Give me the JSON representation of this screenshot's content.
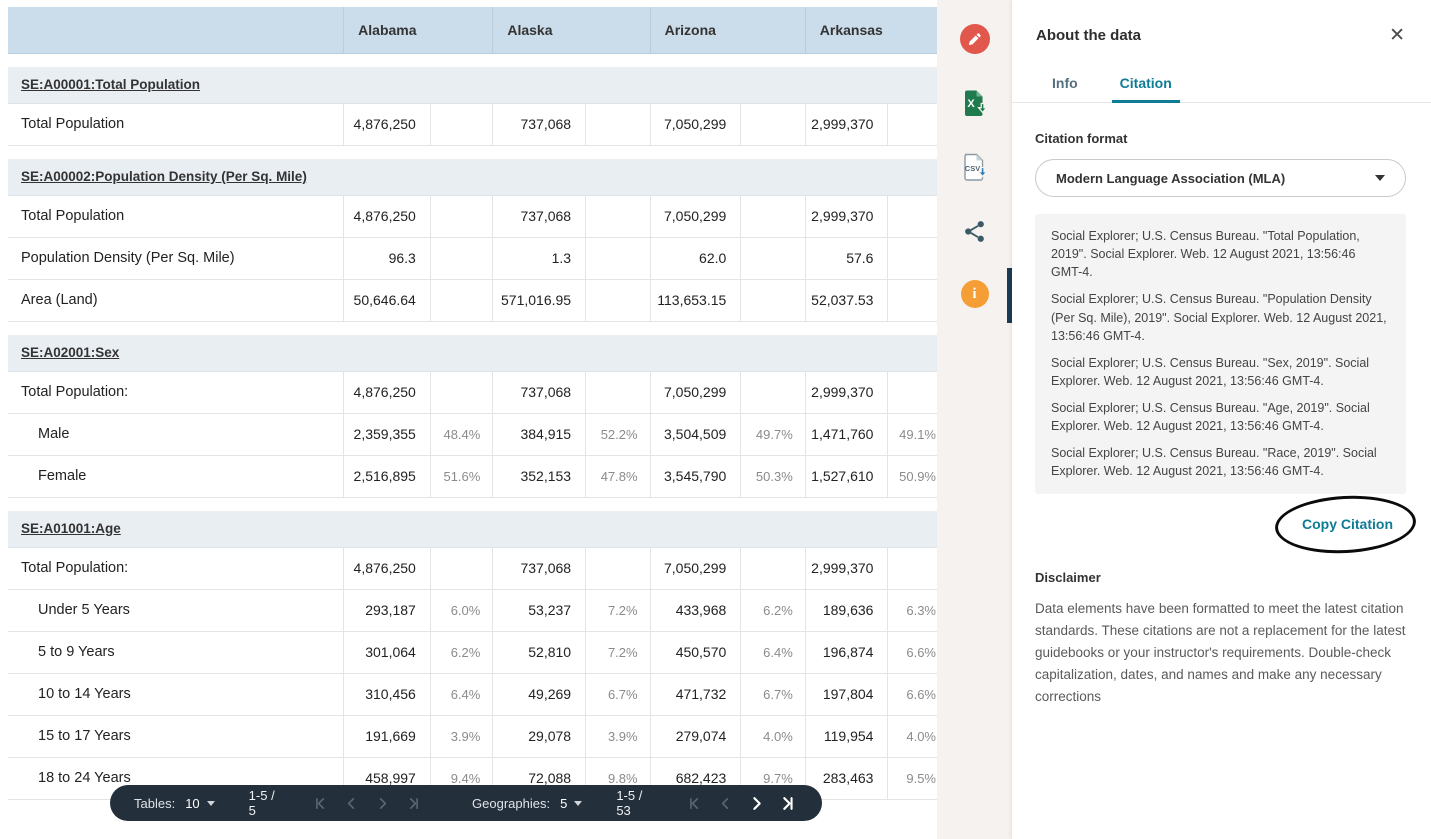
{
  "table": {
    "columns": [
      "Alabama",
      "Alaska",
      "Arizona",
      "Arkansas"
    ],
    "sections": [
      {
        "title": "SE:A00001:Total Population",
        "rows": [
          {
            "label": "Total Population",
            "indent": false,
            "cells": [
              [
                "4,876,250",
                ""
              ],
              [
                "737,068",
                ""
              ],
              [
                "7,050,299",
                ""
              ],
              [
                "2,999,370",
                ""
              ]
            ]
          }
        ]
      },
      {
        "title": "SE:A00002:Population Density (Per Sq. Mile)",
        "rows": [
          {
            "label": "Total Population",
            "indent": false,
            "cells": [
              [
                "4,876,250",
                ""
              ],
              [
                "737,068",
                ""
              ],
              [
                "7,050,299",
                ""
              ],
              [
                "2,999,370",
                ""
              ]
            ]
          },
          {
            "label": "Population Density (Per Sq. Mile)",
            "indent": false,
            "cells": [
              [
                "96.3",
                ""
              ],
              [
                "1.3",
                ""
              ],
              [
                "62.0",
                ""
              ],
              [
                "57.6",
                ""
              ]
            ]
          },
          {
            "label": "Area (Land)",
            "indent": false,
            "cells": [
              [
                "50,646.64",
                ""
              ],
              [
                "571,016.95",
                ""
              ],
              [
                "113,653.15",
                ""
              ],
              [
                "52,037.53",
                ""
              ]
            ]
          }
        ]
      },
      {
        "title": "SE:A02001:Sex",
        "rows": [
          {
            "label": "Total Population:",
            "indent": false,
            "cells": [
              [
                "4,876,250",
                ""
              ],
              [
                "737,068",
                ""
              ],
              [
                "7,050,299",
                ""
              ],
              [
                "2,999,370",
                ""
              ]
            ]
          },
          {
            "label": "Male",
            "indent": true,
            "cells": [
              [
                "2,359,355",
                "48.4%"
              ],
              [
                "384,915",
                "52.2%"
              ],
              [
                "3,504,509",
                "49.7%"
              ],
              [
                "1,471,760",
                "49.1%"
              ]
            ]
          },
          {
            "label": "Female",
            "indent": true,
            "cells": [
              [
                "2,516,895",
                "51.6%"
              ],
              [
                "352,153",
                "47.8%"
              ],
              [
                "3,545,790",
                "50.3%"
              ],
              [
                "1,527,610",
                "50.9%"
              ]
            ]
          }
        ]
      },
      {
        "title": "SE:A01001:Age",
        "rows": [
          {
            "label": "Total Population:",
            "indent": false,
            "cells": [
              [
                "4,876,250",
                ""
              ],
              [
                "737,068",
                ""
              ],
              [
                "7,050,299",
                ""
              ],
              [
                "2,999,370",
                ""
              ]
            ]
          },
          {
            "label": "Under 5 Years",
            "indent": true,
            "cells": [
              [
                "293,187",
                "6.0%"
              ],
              [
                "53,237",
                "7.2%"
              ],
              [
                "433,968",
                "6.2%"
              ],
              [
                "189,636",
                "6.3%"
              ]
            ]
          },
          {
            "label": "5 to 9 Years",
            "indent": true,
            "cells": [
              [
                "301,064",
                "6.2%"
              ],
              [
                "52,810",
                "7.2%"
              ],
              [
                "450,570",
                "6.4%"
              ],
              [
                "196,874",
                "6.6%"
              ]
            ]
          },
          {
            "label": "10 to 14 Years",
            "indent": true,
            "cells": [
              [
                "310,456",
                "6.4%"
              ],
              [
                "49,269",
                "6.7%"
              ],
              [
                "471,732",
                "6.7%"
              ],
              [
                "197,804",
                "6.6%"
              ]
            ]
          },
          {
            "label": "15 to 17 Years",
            "indent": true,
            "cells": [
              [
                "191,669",
                "3.9%"
              ],
              [
                "29,078",
                "3.9%"
              ],
              [
                "279,074",
                "4.0%"
              ],
              [
                "119,954",
                "4.0%"
              ]
            ]
          },
          {
            "label": "18 to 24 Years",
            "indent": true,
            "cells": [
              [
                "458,997",
                "9.4%"
              ],
              [
                "72,088",
                "9.8%"
              ],
              [
                "682,423",
                "9.7%"
              ],
              [
                "283,463",
                "9.5%"
              ]
            ]
          }
        ]
      }
    ]
  },
  "pagination": {
    "tables": {
      "label": "Tables:",
      "page_size": "10",
      "range": "1-5 / 5",
      "nav": {
        "first": false,
        "prev": false,
        "next": false,
        "last": false
      }
    },
    "geographies": {
      "label": "Geographies:",
      "page_size": "5",
      "range": "1-5 / 53",
      "nav": {
        "first": false,
        "prev": false,
        "next": true,
        "last": true
      }
    }
  },
  "toolbar": {
    "tools": [
      "edit",
      "excel-download",
      "csv-download",
      "share",
      "info"
    ],
    "info_glyph": "i",
    "active_tool": "info"
  },
  "panel": {
    "title": "About the data",
    "close_glyph": "✕",
    "tabs": [
      {
        "label": "Info",
        "active": false
      },
      {
        "label": "Citation",
        "active": true
      }
    ],
    "citation_format_label": "Citation format",
    "citation_format_value": "Modern Language Association (MLA)",
    "citations": [
      "Social Explorer; U.S. Census Bureau. \"Total Population, 2019\". Social Explorer. Web. 12 August 2021, 13:56:46 GMT-4.",
      "Social Explorer; U.S. Census Bureau. \"Population Density (Per Sq. Mile), 2019\". Social Explorer. Web. 12 August 2021, 13:56:46 GMT-4.",
      "Social Explorer; U.S. Census Bureau. \"Sex, 2019\". Social Explorer. Web. 12 August 2021, 13:56:46 GMT-4.",
      "Social Explorer; U.S. Census Bureau. \"Age, 2019\". Social Explorer. Web. 12 August 2021, 13:56:46 GMT-4.",
      "Social Explorer; U.S. Census Bureau. \"Race, 2019\". Social Explorer. Web. 12 August 2021, 13:56:46 GMT-4."
    ],
    "copy_button_label": "Copy Citation",
    "disclaimer_label": "Disclaimer",
    "disclaimer_text": "Data elements have been formatted to meet the latest citation standards. These citations are not a replacement for the latest guidebooks or your instructor's requirements. Double-check capitalization, dates, and names and make any necessary corrections"
  },
  "colors": {
    "accent_teal": "#0E7C96",
    "header_blue": "#CBDCEA",
    "section_bg": "#E9EEF3",
    "pagination_navy": "#232F3B",
    "edit_red": "#E2574C",
    "info_orange": "#F59E35",
    "excel_green": "#1F7A4D",
    "csv_arrow_blue": "#2A7AB0",
    "strip_bg": "#F6F2EF"
  }
}
